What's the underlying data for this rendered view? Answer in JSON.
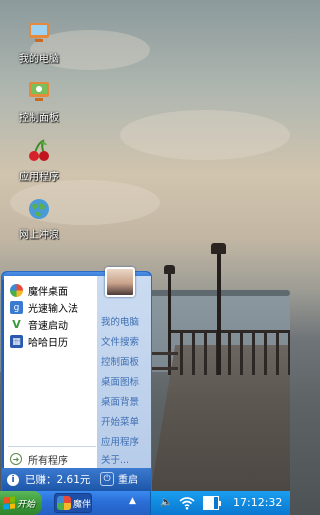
{
  "desktop": {
    "icons": [
      {
        "label": "我的电脑",
        "icon": "computer-icon"
      },
      {
        "label": "控制面板",
        "icon": "control-panel-icon"
      },
      {
        "label": "应用程序",
        "icon": "cherry-icon"
      },
      {
        "label": "网上冲浪",
        "icon": "globe-icon"
      }
    ]
  },
  "start_menu": {
    "left_items": [
      {
        "label": "魔伴桌面",
        "icon": "pinwheel-icon"
      },
      {
        "label": "光速输入法",
        "icon": "keyboard-g-icon"
      },
      {
        "label": "音速启动",
        "icon": "v-launcher-icon"
      },
      {
        "label": "哈哈日历",
        "icon": "calendar-icon"
      }
    ],
    "all_programs": "所有程序",
    "right_items": [
      "我的电脑",
      "文件搜索",
      "控制面板",
      "桌面图标",
      "桌面背景",
      "开始菜单",
      "应用程序",
      "关于..."
    ],
    "earned": "已赚：2.61元",
    "restart": "重启"
  },
  "taskbar": {
    "start_label": "开始",
    "task_label": "魔伴",
    "clock": "17:12:32",
    "battery_level": 0.7
  },
  "colors": {
    "taskbar_blue": "#2a6ed6",
    "start_green": "#3c9a3a",
    "tray_blue": "#108ae0",
    "menu_link_blue": "#3f6fb3"
  }
}
